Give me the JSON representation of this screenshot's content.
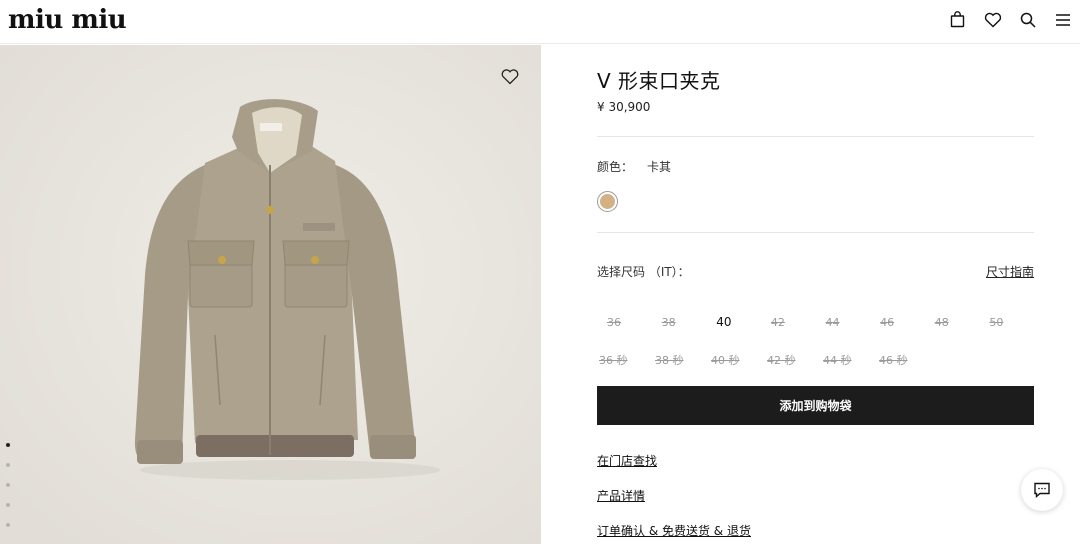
{
  "brand": {
    "logo_text": "miu miu"
  },
  "header": {
    "icons": [
      "bag-icon",
      "heart-icon",
      "search-icon",
      "menu-icon"
    ]
  },
  "gallery": {
    "image_count": 5,
    "active_index": 0,
    "background": "#e9e6e0"
  },
  "product": {
    "title": "V 形束口夹克",
    "price": "¥ 30,900",
    "color_label": "颜色：",
    "color_value": "卡其",
    "swatch_color": "#d4b184",
    "size_label": "选择尺码 （IT）：",
    "size_guide": "尺寸指南",
    "sizes": [
      {
        "label": "36",
        "available": false
      },
      {
        "label": "38",
        "available": false
      },
      {
        "label": "40",
        "available": true
      },
      {
        "label": "42",
        "available": false
      },
      {
        "label": "44",
        "available": false
      },
      {
        "label": "46",
        "available": false
      },
      {
        "label": "48",
        "available": false
      },
      {
        "label": "50",
        "available": false
      }
    ],
    "sizes_r2": [
      {
        "label": "36 秒",
        "available": false
      },
      {
        "label": "38 秒",
        "available": false
      },
      {
        "label": "40 秒",
        "available": false
      },
      {
        "label": "42 秒",
        "available": false
      },
      {
        "label": "44 秒",
        "available": false
      },
      {
        "label": "46 秒",
        "available": false
      }
    ],
    "add_to_bag": "添加到购物袋",
    "links": [
      "在门店查找",
      "产品详情",
      "订单确认 & 免费送货 & 退货"
    ]
  },
  "colors": {
    "button_bg": "#1c1c1c",
    "button_text": "#ffffff"
  }
}
